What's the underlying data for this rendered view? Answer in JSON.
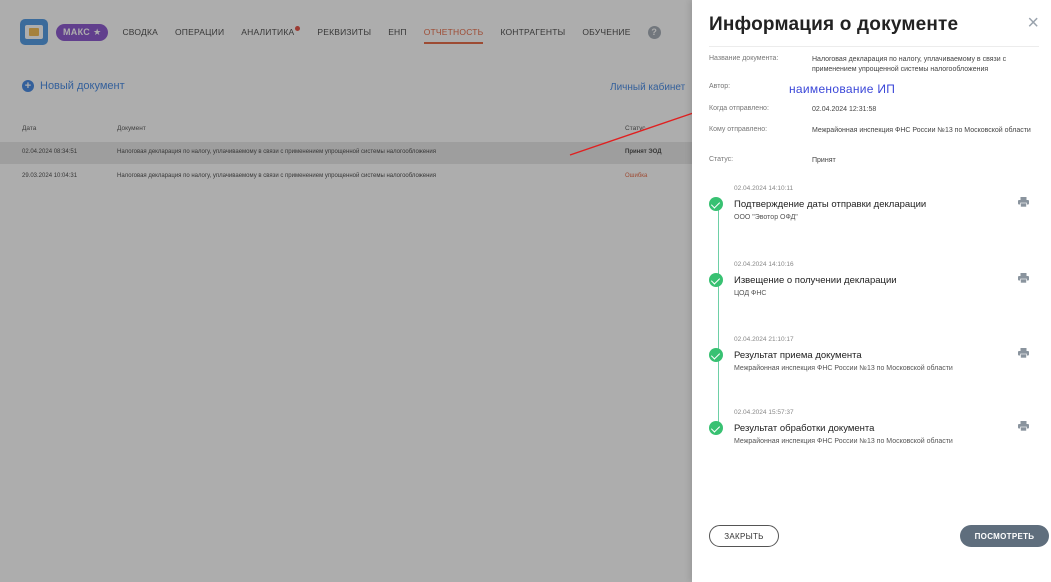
{
  "nav": {
    "badge": "МАКС",
    "items": [
      "СВОДКА",
      "ОПЕРАЦИИ",
      "АНАЛИТИКА",
      "РЕКВИЗИТЫ",
      "ЕНП",
      "ОТЧЕТНОСТЬ",
      "КОНТРАГЕНТЫ",
      "ОБУЧЕНИЕ"
    ],
    "active": "ОТЧЕТНОСТЬ",
    "help": "?"
  },
  "main": {
    "new_doc": "Новый документ",
    "cabinet": "Личный кабинет",
    "headers": {
      "date": "Дата",
      "document": "Документ",
      "status": "Статус"
    },
    "rows": [
      {
        "date": "02.04.2024 08:34:51",
        "doc": "Налоговая декларация по налогу, уплачиваемому в связи с применением упрощенной системы налогообложения",
        "status": "Принят ЭОД"
      },
      {
        "date": "29.03.2024 10:04:31",
        "doc": "Налоговая декларация по налогу, уплачиваемому в связи с применением упрощенной системы налогообложения",
        "status": "Ошибка"
      }
    ]
  },
  "panel": {
    "title": "Информация о документе",
    "close_icon": "×",
    "fields": {
      "name_label": "Название документа:",
      "name_value": "Налоговая декларация по налогу, уплачиваемому в связи с применением упрощенной системы налогообложения",
      "author_label": "Автор:",
      "author_value": "наименование ИП",
      "sent_label": "Когда отправлено:",
      "sent_value": "02.04.2024 12:31:58",
      "to_label": "Кому отправлено:",
      "to_value": "Межрайонная инспекция ФНС России №13 по Московской области",
      "status_label": "Статус:",
      "status_value": "Принят"
    },
    "events": [
      {
        "date": "02.04.2024 14:10:11",
        "name": "Подтверждение даты отправки декларации",
        "org": "ООО \"Эвотор ОФД\""
      },
      {
        "date": "02.04.2024 14:10:16",
        "name": "Извещение о получении декларации",
        "org": "ЦОД ФНС"
      },
      {
        "date": "02.04.2024 21:10:17",
        "name": "Результат приема документа",
        "org": "Межрайонная инспекция ФНС России №13 по Московской области"
      },
      {
        "date": "02.04.2024 15:57:37",
        "name": "Результат обработки документа",
        "org": "Межрайонная инспекция ФНС России №13 по Московской области"
      }
    ],
    "btn_close": "ЗАКРЫТЬ",
    "btn_view": "ПОСМОТРЕТЬ"
  },
  "colors": {
    "accent": "#e4572e",
    "link": "#2f7be0",
    "success": "#38c172",
    "badge": "#7d43c9",
    "annotation": "#e02020"
  }
}
